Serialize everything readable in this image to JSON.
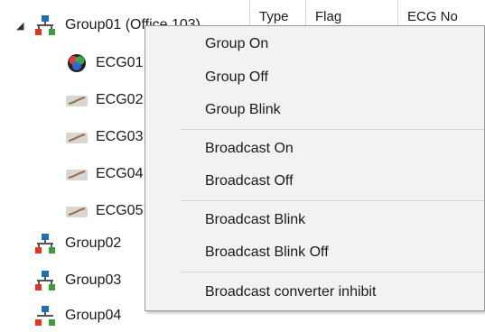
{
  "tree": {
    "nodes": [
      {
        "label": "Group01 (Office 103)",
        "kind": "group",
        "expanded": true
      },
      {
        "label": "ECG01",
        "kind": "rgb"
      },
      {
        "label": "ECG02",
        "kind": "ecg"
      },
      {
        "label": "ECG03",
        "kind": "ecg"
      },
      {
        "label": "ECG04",
        "kind": "ecg"
      },
      {
        "label": "ECG05",
        "kind": "ecg"
      },
      {
        "label": "Group02",
        "kind": "group"
      },
      {
        "label": "Group03",
        "kind": "group"
      },
      {
        "label": "Group04",
        "kind": "group"
      }
    ]
  },
  "grid": {
    "columns": [
      "Type",
      "Flag",
      "ECG No"
    ]
  },
  "context_menu": {
    "items": [
      "Group On",
      "Group Off",
      "Group Blink",
      "Broadcast On",
      "Broadcast Off",
      "Broadcast Blink",
      "Broadcast Blink Off",
      "Broadcast converter inhibit"
    ]
  },
  "icons": {
    "group": "network-group-icon",
    "rgb": "rgb-color-icon",
    "ecg": "ecg-device-icon"
  },
  "colors": {
    "group_blue": "#1f6fb2",
    "group_red": "#d9372b",
    "group_green": "#3d9a3d",
    "menu_bg": "#f2f2f2"
  }
}
